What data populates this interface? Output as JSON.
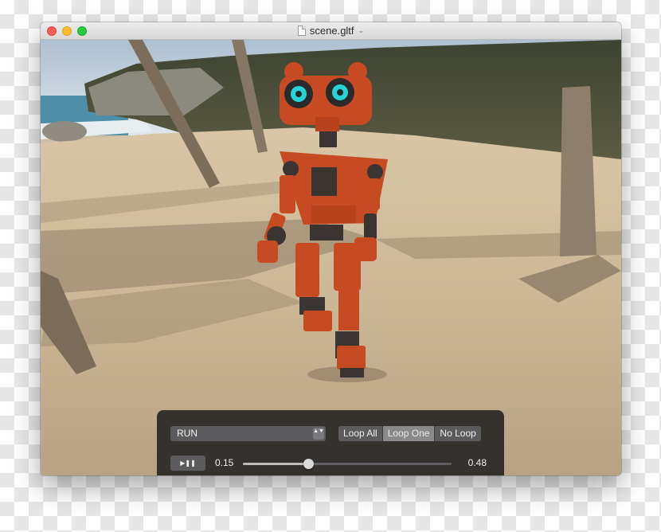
{
  "window": {
    "title": "scene.gltf",
    "controls": [
      "close",
      "minimize",
      "zoom"
    ]
  },
  "icons": {
    "document": "document-icon",
    "title_menu": "chevron-down-icon",
    "select_stepper": "up-down-chevron-icon",
    "play_pause": "play-pause-icon"
  },
  "scene": {
    "description_free": true,
    "colors": {
      "robot": "#c64a22",
      "eyes": "#29d0d6",
      "sand": "#cdbb9c"
    }
  },
  "hud": {
    "animation": {
      "selected": "RUN",
      "stepper_glyph": "▲▼"
    },
    "loop_modes": [
      {
        "label": "Loop All",
        "active": false
      },
      {
        "label": "Loop One",
        "active": true
      },
      {
        "label": "No Loop",
        "active": false
      }
    ],
    "playback": {
      "button_glyph": "▶❚❚",
      "current_time": "0.15",
      "end_time": "0.48",
      "progress": 0.3125
    }
  }
}
